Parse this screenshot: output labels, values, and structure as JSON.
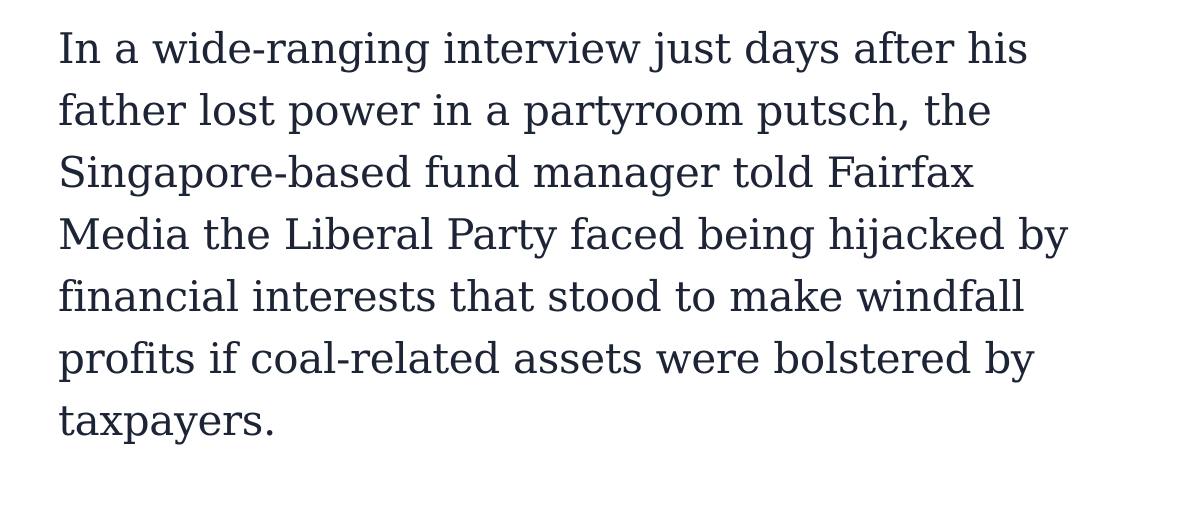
{
  "article": {
    "paragraph_lines": [
      "In a wide-ranging interview just days after his",
      "father lost power in a partyroom putsch, the",
      "Singapore-based fund manager told Fairfax",
      "Media the Liberal Party faced being hijacked by",
      "financial interests that stood to make windfall",
      "profits if coal-related assets were bolstered by",
      "taxpayers."
    ]
  },
  "colors": {
    "text": "#1d2436",
    "background": "#ffffff"
  }
}
